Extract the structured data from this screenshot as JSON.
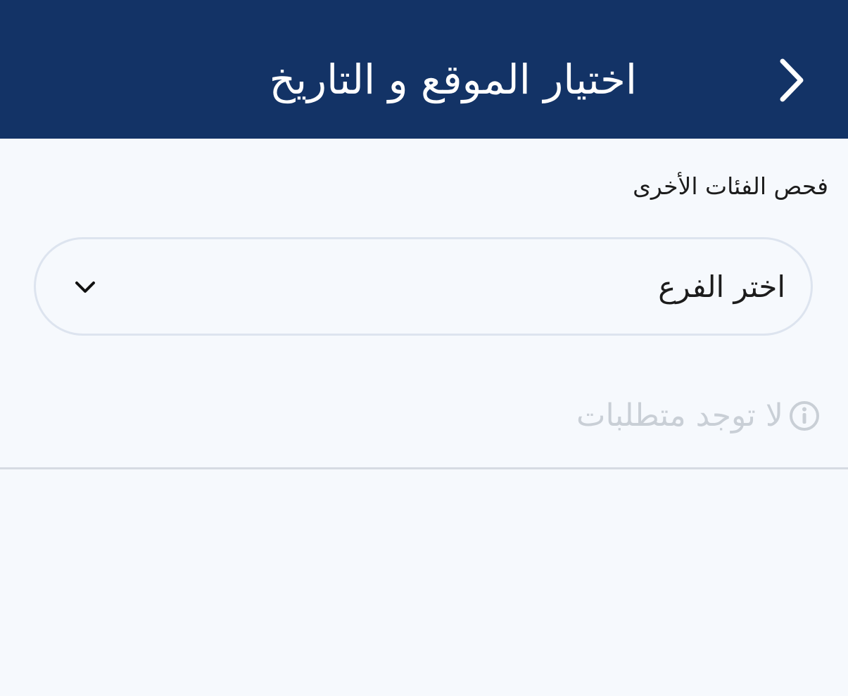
{
  "header": {
    "title": "اختيار الموقع و التاريخ",
    "back_icon": "chevron-right-icon",
    "background_color": "#133366"
  },
  "section": {
    "label": "فحص الفئات الأخرى"
  },
  "branch_select": {
    "selected_value": "اختر الفرع",
    "icon": "chevron-down-icon"
  },
  "requirements": {
    "icon": "info-icon",
    "message": "لا توجد متطلبات"
  },
  "colors": {
    "page_background": "#f6f9fd",
    "muted_text": "#c9cfd6",
    "border": "#dde4ef"
  }
}
